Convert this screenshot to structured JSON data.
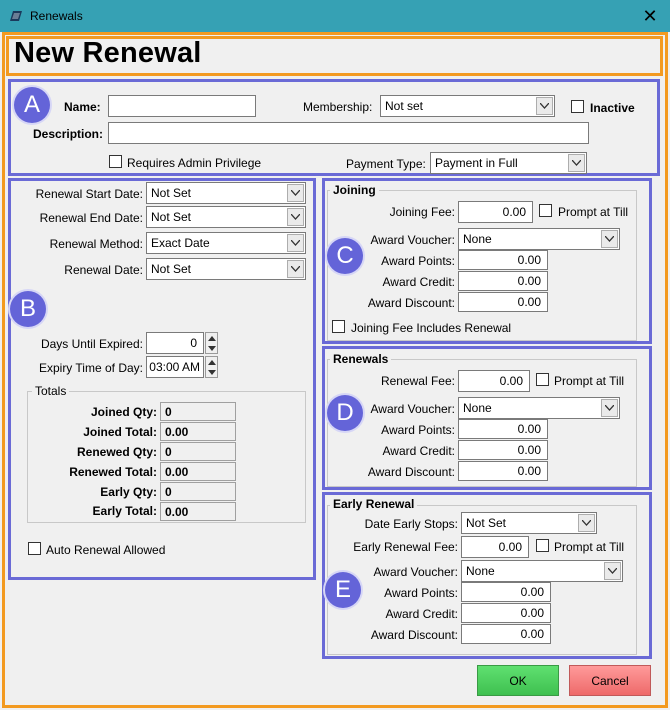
{
  "window": {
    "title": "Renewals",
    "close_glyph": "✕"
  },
  "page_title": "New Renewal",
  "badges": {
    "a": "A",
    "b": "B",
    "c": "C",
    "d": "D",
    "e": "E"
  },
  "section_a": {
    "name_label": "Name:",
    "name_value": "",
    "membership_label": "Membership:",
    "membership_value": "Not set",
    "inactive_label": "Inactive",
    "description_label": "Description:",
    "description_value": "",
    "requires_admin_label": "Requires Admin Privilege",
    "payment_type_label": "Payment Type:",
    "payment_type_value": "Payment in Full"
  },
  "section_b": {
    "renewal_start_label": "Renewal Start Date:",
    "renewal_start_value": "Not Set",
    "renewal_end_label": "Renewal End Date:",
    "renewal_end_value": "Not Set",
    "renewal_method_label": "Renewal Method:",
    "renewal_method_value": "Exact Date",
    "renewal_date_label": "Renewal Date:",
    "renewal_date_value": "Not Set",
    "days_until_expired_label": "Days Until Expired:",
    "days_until_expired_value": "0",
    "expiry_time_label": "Expiry Time of Day:",
    "expiry_time_value": "03:00 AM",
    "totals_title": "Totals",
    "totals": [
      {
        "label": "Joined Qty:",
        "value": "0"
      },
      {
        "label": "Joined Total:",
        "value": "0.00"
      },
      {
        "label": "Renewed Qty:",
        "value": "0"
      },
      {
        "label": "Renewed Total:",
        "value": "0.00"
      },
      {
        "label": "Early Qty:",
        "value": "0"
      },
      {
        "label": "Early Total:",
        "value": "0.00"
      }
    ],
    "auto_renewal_label": "Auto Renewal Allowed"
  },
  "section_c": {
    "title": "Joining",
    "fee_label": "Joining Fee:",
    "fee_value": "0.00",
    "prompt_label": "Prompt at Till",
    "voucher_label": "Award Voucher:",
    "voucher_value": "None",
    "points_label": "Award Points:",
    "points_value": "0.00",
    "credit_label": "Award Credit:",
    "credit_value": "0.00",
    "discount_label": "Award Discount:",
    "discount_value": "0.00",
    "includes_renewal_label": "Joining Fee Includes Renewal"
  },
  "section_d": {
    "title": "Renewals",
    "fee_label": "Renewal Fee:",
    "fee_value": "0.00",
    "prompt_label": "Prompt at Till",
    "voucher_label": "Award Voucher:",
    "voucher_value": "None",
    "points_label": "Award Points:",
    "points_value": "0.00",
    "credit_label": "Award Credit:",
    "credit_value": "0.00",
    "discount_label": "Award Discount:",
    "discount_value": "0.00"
  },
  "section_e": {
    "title": "Early Renewal",
    "date_early_stops_label": "Date Early Stops:",
    "date_early_stops_value": "Not Set",
    "fee_label": "Early Renewal Fee:",
    "fee_value": "0.00",
    "prompt_label": "Prompt at Till",
    "voucher_label": "Award Voucher:",
    "voucher_value": "None",
    "points_label": "Award Points:",
    "points_value": "0.00",
    "credit_label": "Award Credit:",
    "credit_value": "0.00",
    "discount_label": "Award Discount:",
    "discount_value": "0.00"
  },
  "buttons": {
    "ok": "OK",
    "cancel": "Cancel"
  },
  "colors": {
    "titlebar": "#36a1b4",
    "highlight_orange": "#f39a20",
    "section_purple": "#6a6ad6",
    "ok_green": "#4fd35f",
    "cancel_red": "#f37c7c"
  }
}
